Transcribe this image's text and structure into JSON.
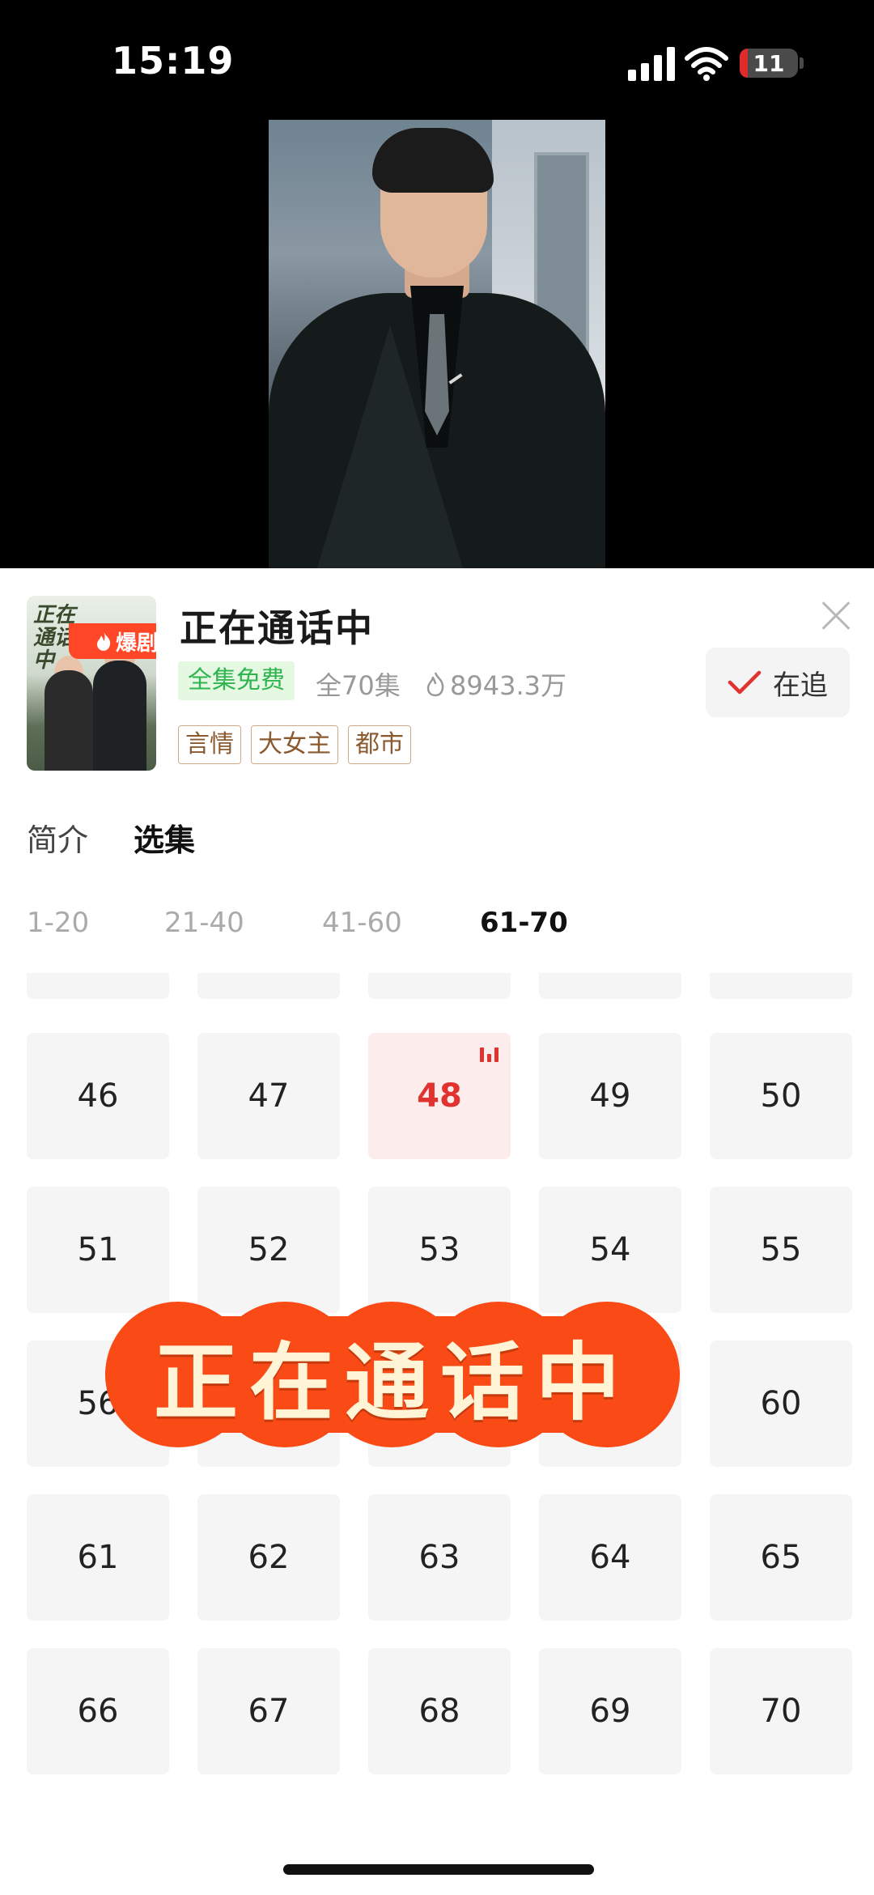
{
  "status_bar": {
    "time": "15:19",
    "battery": "11"
  },
  "drama": {
    "title": "正在通话中",
    "poster_title": "正在通话中",
    "badge": "爆剧",
    "free_label": "全集免费",
    "episode_count": "全70集",
    "heat": "8943.3万",
    "follow_label": "在追",
    "tags": [
      "言情",
      "大女主",
      "都市"
    ]
  },
  "tabs": [
    "简介",
    "选集"
  ],
  "active_tab": "选集",
  "ranges": [
    "1-20",
    "21-40",
    "41-60",
    "61-70"
  ],
  "active_range": "61-70",
  "episodes": {
    "rows": [
      [
        "46",
        "47",
        "48",
        "49",
        "50"
      ],
      [
        "51",
        "52",
        "53",
        "54",
        "55"
      ],
      [
        "56",
        "",
        "",
        "",
        "60"
      ],
      [
        "61",
        "62",
        "63",
        "64",
        "65"
      ],
      [
        "66",
        "67",
        "68",
        "69",
        "70"
      ]
    ],
    "playing": "48"
  },
  "overlay_title": "正在通话中",
  "colors": {
    "accent": "#fa4a16",
    "playing": "#e0332f",
    "free": "#2fb44f",
    "tag": "#8a5a2e"
  }
}
